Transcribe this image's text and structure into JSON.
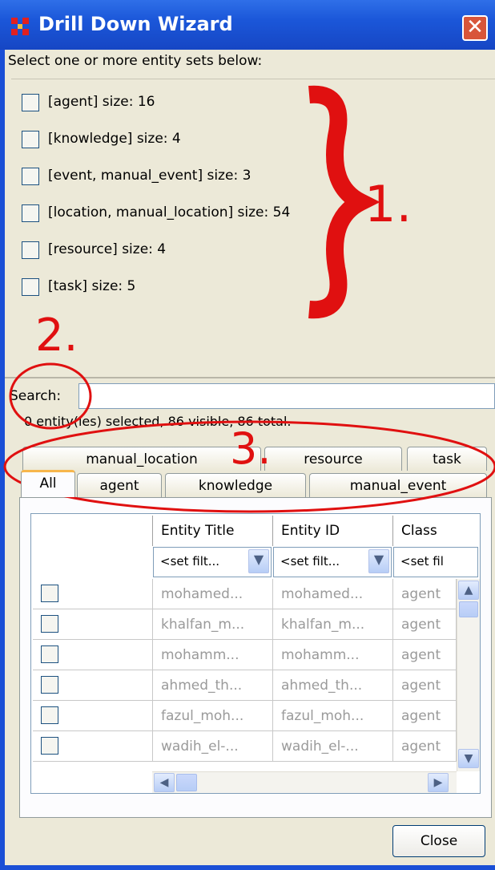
{
  "window": {
    "title": "Drill Down Wizard",
    "close_glyph": "✕"
  },
  "prompt": "Select one or more entity sets below:",
  "entity_sets": [
    {
      "label": "[agent] size: 16"
    },
    {
      "label": "[knowledge] size: 4"
    },
    {
      "label": "[event, manual_event] size: 3"
    },
    {
      "label": "[location, manual_location] size: 54"
    },
    {
      "label": "[resource] size: 4"
    },
    {
      "label": "[task] size: 5"
    }
  ],
  "search": {
    "label": "Search:",
    "value": ""
  },
  "status": "0 entity(ies) selected, 86 visible, 86 total.",
  "tabs_back": [
    "manual_location",
    "resource",
    "task"
  ],
  "tabs_front": [
    "All",
    "agent",
    "knowledge",
    "manual_event"
  ],
  "active_tab": "All",
  "table": {
    "columns": [
      "Entity Title",
      "Entity ID",
      "Class"
    ],
    "filters": [
      "<set filt...",
      "<set filt...",
      "<set fil"
    ],
    "rows": [
      {
        "title": "mohamed...",
        "id": "mohamed...",
        "class": "agent"
      },
      {
        "title": "khalfan_m...",
        "id": "khalfan_m...",
        "class": "agent"
      },
      {
        "title": "mohamm...",
        "id": "mohamm...",
        "class": "agent"
      },
      {
        "title": "ahmed_th...",
        "id": "ahmed_th...",
        "class": "agent"
      },
      {
        "title": "fazul_moh...",
        "id": "fazul_moh...",
        "class": "agent"
      },
      {
        "title": "wadih_el-...",
        "id": "wadih_el-...",
        "class": "agent"
      }
    ]
  },
  "close_button": "Close",
  "annotations": {
    "label_1": "1.",
    "label_2": "2.",
    "label_3": "3.",
    "color": "#e01010"
  },
  "icons": {
    "app_icon": "red-grid-icon",
    "dropdown": "chevron-down-icon",
    "scroll_up": "triangle-up-icon",
    "scroll_down": "triangle-down-icon",
    "scroll_left": "triangle-left-icon",
    "scroll_right": "triangle-right-icon"
  }
}
